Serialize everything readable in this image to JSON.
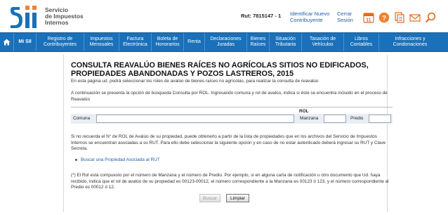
{
  "header": {
    "logo_lines": [
      "Servicio",
      "de Impuestos",
      "Internos"
    ],
    "rut_label": "Rut:",
    "rut_value": "7815147 - 1",
    "identify_link": "Identificar Nuevo Contribuyente",
    "logout_link": "Cerrar Sesión",
    "calendar_day": "11",
    "icons": [
      "calendar-icon",
      "help-icon",
      "documents-icon",
      "mail-icon",
      "search-icon"
    ],
    "brand_color": "#1a70b9",
    "accent_orange": "#f0822d"
  },
  "nav": {
    "home_icon": "home-icon",
    "items": [
      "Mi SII",
      "Registro de Contribuyentes",
      "Impuestos Mensuales",
      "Factura Electrónica",
      "Boleta de Honorarios",
      "Renta",
      "Declaraciones Juradas",
      "Bienes Raíces",
      "Situación Tributaria",
      "Tasación de Vehículos",
      "Libros Contables",
      "Infracciones y Condonaciones"
    ]
  },
  "page": {
    "title": "CONSULTA REAVALÚO BIENES RAÍCES NO AGRÍCOLAS SITIOS NO EDIFICADOS, PROPIEDADES ABANDONADAS Y POZOS LASTREROS, 2015",
    "subtitle": "En esta página ud. podrá seleccionar los roles de avalúo de bienes raíces no agrícolas, para realizar la consulta de reavalúo",
    "intro": "A continuación se presenta la opción de búsqueda Consulta por ROL. Ingresando comuna y rol de avalúo, indica si éste se encuentra incluido en el proceso de Reavalúo",
    "form": {
      "rol_label": "ROL",
      "comuna_label": "Comuna",
      "comuna_value": "",
      "manzana_label": "Manzana",
      "manzana_value": "",
      "predio_label": "Predio",
      "predio_value": ""
    },
    "para2": "Si no recuerda el N° de ROL de Avalúo de su propiedad, puede obtenerlo a partir de la lista de propiedades que en los archivos del Servicio de Impuestos Internos se encuentran asociadas a su RUT. Para ello debe seleccionar la siguiente opción y en caso de no estar autenticado deberá ingresar su RUT y Clave Secreta.",
    "link": "Buscar una Propiedad Asociada al RUT",
    "note": "(*) El Rol está compuesto por el número de Manzana y el número de Predio. Por ejemplo, si en alguna carta de notificación u otro documento que Ud. haya recibido, indica que el rol de avalúo de su propiedad es 00123-00012, el número correspondiente a la Manzana es 00123 ó 123, y el número correspondiente al Predio es 00012 ó 12.",
    "buttons": {
      "search": "Buscar",
      "clear": "Limpiar"
    }
  }
}
